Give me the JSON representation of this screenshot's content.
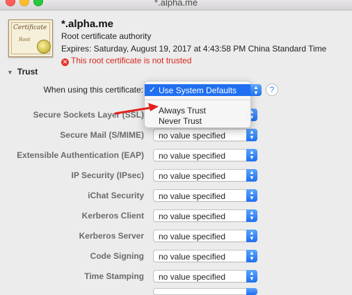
{
  "window": {
    "title": "*.alpha.me"
  },
  "certificate": {
    "icon_word": "Certificate",
    "icon_root": "Root",
    "name": "*.alpha.me",
    "type": "Root certificate authority",
    "expires": "Expires: Saturday, August 19, 2017 at 4:43:58 PM China Standard Time",
    "warning": "This root certificate is not trusted"
  },
  "trust": {
    "section_label": "Trust",
    "when_using_label": "When using this certificate:",
    "when_using_value": "Use System Defaults",
    "help_label": "?",
    "dropdown": {
      "selected": "Use System Defaults",
      "options": [
        "Always Trust",
        "Never Trust"
      ]
    },
    "rows": [
      {
        "label": "Secure Sockets Layer (SSL)",
        "value": ""
      },
      {
        "label": "Secure Mail (S/MIME)",
        "value": "no value specified"
      },
      {
        "label": "Extensible Authentication (EAP)",
        "value": "no value specified"
      },
      {
        "label": "IP Security (IPsec)",
        "value": "no value specified"
      },
      {
        "label": "iChat Security",
        "value": "no value specified"
      },
      {
        "label": "Kerberos Client",
        "value": "no value specified"
      },
      {
        "label": "Kerberos Server",
        "value": "no value specified"
      },
      {
        "label": "Code Signing",
        "value": "no value specified"
      },
      {
        "label": "Time Stamping",
        "value": "no value specified"
      }
    ]
  },
  "colors": {
    "accent": "#1f6ff0",
    "warning": "#d8261c",
    "arrow": "#e3221c"
  },
  "icons": [
    "certificate-icon",
    "error-icon",
    "disclosure-triangle-icon",
    "checkmark-icon",
    "stepper-icon",
    "help-icon",
    "red-arrow-annotation"
  ]
}
